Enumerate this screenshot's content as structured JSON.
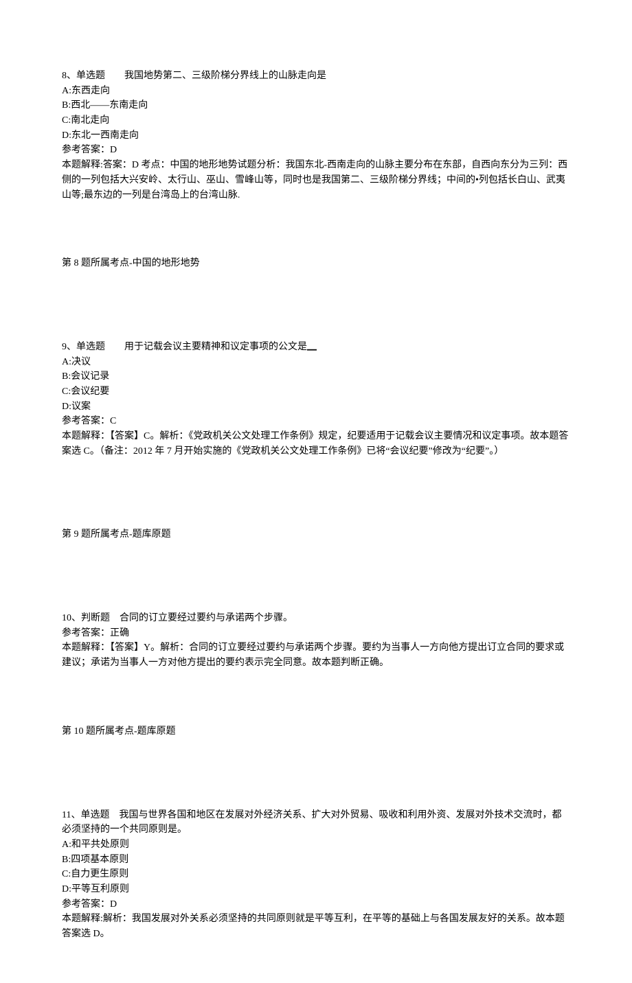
{
  "q8": {
    "header_num": "8、单选题",
    "header_text": "我国地势第二、三级阶梯分界线上的山脉走向是",
    "opts": {
      "a": "A:东西走向",
      "b": "B:西北——东南走向",
      "c": "C:南北走向",
      "d": "D:东北一西南走向"
    },
    "ans_label": "参考答案：D",
    "exp_l1": "本题解释:答案：D 考点：中国的地形地势试题分析：我国东北-西南走向的山脉主要分布在东部，自西向东分为三列：西侧的一列包括大兴安岭、太行山、巫山、雪峰山等，同时也是我国第二、三级阶梯分界线；中间的•列包括长白山、武夷山等;最东边的一列是台湾岛上的台湾山脉.",
    "ref": "第 8 题所属考点-中国的地形地势"
  },
  "q9": {
    "header_num": "9、单选题",
    "header_text": "用于记载会议主要精神和议定事项的公文是▁",
    "opts": {
      "a": "A:决议",
      "b": "B:会议记录",
      "c": "C:会议纪要",
      "d": "D:议案"
    },
    "ans_label": "参考答案：C",
    "exp_l1": "本题解释：【答案】C。解析：《党政机关公文处理工作条例》规定，纪要适用于记载会议主要情况和议定事项。故本题答案选 C。（备注：2012 年 7 月开始实施的《党政机关公文处理工作条例》已将“会议纪要”修改为“纪要”。）",
    "ref": "第 9 题所属考点-题库原题"
  },
  "q10": {
    "header_num": "10、判断题",
    "header_text": "合同的订立要经过要约与承诺两个步骤。",
    "ans_label": "参考答案：正确",
    "exp_l1": "本题解释：【答案】Y。解析：合同的订立要经过要约与承诺两个步骤。要约为当事人一方向他方提出订立合同的要求或建议；承诺为当事人一方对他方提出的要约表示完全同意。故本题判断正确。",
    "ref": "第 10 题所属考点-题库原题"
  },
  "q11": {
    "header_num": "11、单选题",
    "header_text": "我国与世界各国和地区在发展对外经济关系、扩大对外贸易、吸收和利用外资、发展对外技术交流时，都必须坚持的一个共同原则是。",
    "opts": {
      "a": "A:和平共处原则",
      "b": "B:四项基本原则",
      "c": "C:自力更生原则",
      "d": "D:平等互利原则"
    },
    "ans_label": "参考答案：D",
    "exp_l1": "本题解释:解析：我国发展对外关系必须坚持的共同原则就是平等互利，在平等的基础上与各国发展友好的关系。故本题答案选 D。"
  }
}
